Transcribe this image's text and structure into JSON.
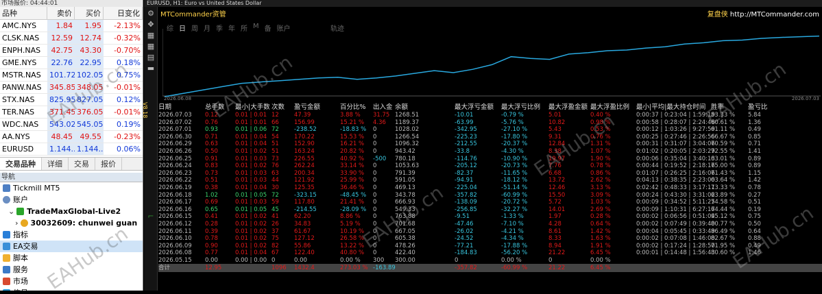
{
  "market_watch": {
    "title": "市场报价: 04:44:01",
    "headers": [
      "品种",
      "卖价",
      "买价",
      "日变化"
    ],
    "rows": [
      {
        "sym": "AMC.NYS",
        "bid": "1.84",
        "ask": "1.95",
        "chg": "-2.13%",
        "dir": "dn"
      },
      {
        "sym": "CLSK.NAS",
        "bid": "12.59",
        "ask": "12.74",
        "chg": "-0.32%",
        "dir": "dn"
      },
      {
        "sym": "ENPH.NAS",
        "bid": "42.75",
        "ask": "43.30",
        "chg": "-0.70%",
        "dir": "dn"
      },
      {
        "sym": "GME.NYS",
        "bid": "22.76",
        "ask": "22.95",
        "chg": "0.18%",
        "dir": "up"
      },
      {
        "sym": "MSTR.NAS",
        "bid": "101.72",
        "ask": "102.05",
        "chg": "0.75%",
        "dir": "up"
      },
      {
        "sym": "PANW.NAS",
        "bid": "345.85",
        "ask": "348.05",
        "chg": "-0.01%",
        "dir": "dn"
      },
      {
        "sym": "STX.NAS",
        "bid": "825.95",
        "ask": "827.05",
        "chg": "0.12%",
        "dir": "up"
      },
      {
        "sym": "TER.NAS",
        "bid": "371.45",
        "ask": "376.05",
        "chg": "-0.01%",
        "dir": "dn"
      },
      {
        "sym": "WDC.NAS",
        "bid": "543.02",
        "ask": "545.05",
        "chg": "0.19%",
        "dir": "up"
      },
      {
        "sym": "AA.NYS",
        "bid": "48.45",
        "ask": "49.55",
        "chg": "-0.23%",
        "dir": "dn"
      },
      {
        "sym": "EURUSD",
        "bid": "1.144...",
        "ask": "1.144...",
        "chg": "0.06%",
        "dir": "up"
      }
    ],
    "tabs": [
      "交易品种",
      "详细",
      "交易",
      "报价"
    ]
  },
  "navigator": {
    "title": "导航",
    "items": [
      "Tickmill MT5",
      "账户",
      "TradeMaxGlobal-Live2",
      "30032609: chunwei guan",
      "指标",
      "EA交易",
      "脚本",
      "服务",
      "市场",
      "信号"
    ]
  },
  "chart_header": "EURUSD, H1: Euro vs United States Dollar",
  "panel": {
    "title": "MTCommander资管",
    "fuping_label": "复盘侠",
    "url": "http://MTCommander.com",
    "tabs": [
      "综",
      "日",
      "周",
      "月",
      "季",
      "年",
      "所",
      "M",
      "备",
      "账户"
    ],
    "track_label": "轨迹",
    "date_start": "2026.06.08",
    "date_end": "2026.07.03",
    "side_label": "V8.18",
    "watermark": "EAHub.cn"
  },
  "chart_data": {
    "type": "line",
    "x": [
      "2026.06.08",
      "2026.07.03"
    ],
    "values": [
      0,
      10,
      20,
      30,
      40,
      44,
      48,
      52,
      56,
      58,
      52,
      56,
      62,
      70,
      78,
      72,
      82,
      96,
      120,
      115,
      112,
      128,
      132,
      138,
      140,
      146,
      150,
      158,
      162,
      168,
      170,
      175,
      178,
      180,
      182
    ],
    "color": "#29a9e0"
  },
  "table": {
    "headers": [
      "日期",
      "总手数",
      "最小|大手数",
      "次数",
      "盈亏金额",
      "百分比%",
      "出入金",
      "余额",
      "最大浮亏金额",
      "最大浮亏比例",
      "最大浮盈金额",
      "最大浮盈比例",
      "最小|平均|最大持仓时间",
      "胜率",
      "盈亏比"
    ],
    "rows": [
      [
        "2026.07.03",
        "0.12",
        "0.01 | 0.01",
        "12",
        "47.39",
        "3.88 %",
        "31.75",
        "1268.51",
        "-10.01",
        "-0.79 %",
        "5.01",
        "0.40 %",
        "0:00:37 | 0:23:04 | 1:59:15",
        "83.33 %",
        "5.84",
        "r"
      ],
      [
        "2026.07.02",
        "0.76",
        "0.01 | 0.01",
        "66",
        "156.99",
        "15.21 %",
        "4.36",
        "1189.37",
        "-63.99",
        "-5.76 %",
        "10.82",
        "0.98 %",
        "0:00:58 | 0:28:07 | 2:24:48",
        "60.61 %",
        "1.36",
        "r"
      ],
      [
        "2026.07.01",
        "0.93",
        "0.01 | 0.06",
        "72",
        "-238.52",
        "-18.83 %",
        "0",
        "1028.02",
        "-342.95",
        "-27.10 %",
        "5.43",
        "0.53 %",
        "0:00:12 | 1:03:26 | 9:27:59",
        "61.11 %",
        "0.49",
        "g"
      ],
      [
        "2026.06.30",
        "0.71",
        "0.01 | 0.04",
        "54",
        "170.22",
        "15.53 %",
        "0",
        "1266.54",
        "-225.23",
        "-17.80 %",
        "9.31",
        "0.76 %",
        "0:00:25 | 0:27:46 | 2:26:56",
        "66.67 %",
        "0.85",
        "r"
      ],
      [
        "2026.06.29",
        "0.63",
        "0.01 | 0.04",
        "51",
        "152.90",
        "16.21 %",
        "0",
        "1096.32",
        "-212.55",
        "-20.37 %",
        "12.84",
        "1.31 %",
        "0:00:31 | 0:31:07 | 3:04:06",
        "70.59 %",
        "0.71",
        "r"
      ],
      [
        "2026.06.26",
        "0.50",
        "0.01 | 0.02",
        "51",
        "163.24",
        "20.82 %",
        "0",
        "943.42",
        "-33.8",
        "-4.30 %",
        "8.38",
        "1.07 %",
        "0:01:02 | 0:20:05 | 2:03:29",
        "72.55 %",
        "1.41",
        "r"
      ],
      [
        "2026.06.25",
        "0.91",
        "0.01 | 0.03",
        "73",
        "226.55",
        "40.92 %",
        "-500",
        "780.18",
        "-114.76",
        "-10.90 %",
        "19.97",
        "1.90 %",
        "0:00:06 | 0:35:04 | 3:40:13",
        "63.01 %",
        "0.89",
        "r"
      ],
      [
        "2026.06.24",
        "0.83",
        "0.01 | 0.02",
        "76",
        "262.24",
        "33.14 %",
        "0",
        "1053.63",
        "-205.12",
        "-20.73 %",
        "7.76",
        "0.78 %",
        "0:00:44 | 0:19:52 | 2:18:16",
        "75.00 %",
        "0.89",
        "r"
      ],
      [
        "2026.06.23",
        "0.73",
        "0.01 | 0.03",
        "63",
        "200.34",
        "33.90 %",
        "0",
        "791.39",
        "-82.37",
        "-11.65 %",
        "6.68",
        "0.86 %",
        "0:01:07 | 0:26:25 | 2:16:06",
        "71.43 %",
        "1.15",
        "r"
      ],
      [
        "2026.06.22",
        "0.51",
        "0.01 | 0.03",
        "44",
        "121.92",
        "25.99 %",
        "0",
        "591.05",
        "-94.91",
        "-18.12 %",
        "13.72",
        "2.62 %",
        "0:04:13 | 0:38:35 | 2:23:00",
        "63.64 %",
        "1.42",
        "r"
      ],
      [
        "2026.06.19",
        "0.38",
        "0.01 | 0.04",
        "30",
        "125.35",
        "36.46 %",
        "0",
        "469.13",
        "-225.04",
        "-51.14 %",
        "12.46",
        "3.13 %",
        "0:02:42 | 0:48:33 | 3:17:11",
        "73.33 %",
        "0.78",
        "r"
      ],
      [
        "2026.06.18",
        "1.02",
        "0.01 | 0.05",
        "72",
        "-323.15",
        "-48.45 %",
        "0",
        "343.78",
        "-357.82",
        "-60.99 %",
        "15.50",
        "3.09 %",
        "0:00:24 | 0:43:30 | 3:31:02",
        "63.89 %",
        "0.27",
        "g"
      ],
      [
        "2026.06.17",
        "0.69",
        "0.01 | 0.03",
        "59",
        "117.80",
        "21.41 %",
        "0",
        "666.93",
        "-138.09",
        "-20.72 %",
        "5.72",
        "1.03 %",
        "0:00:09 | 0:34:52 | 5:11:25",
        "74.58 %",
        "0.51",
        "r"
      ],
      [
        "2026.06.16",
        "0.65",
        "0.01 | 0.05",
        "45",
        "-214.55",
        "-28.09 %",
        "0",
        "549.33",
        "-256.85",
        "-32.27 %",
        "14.01",
        "2.69 %",
        "0:00:09 | 1:10:31 | 6:27:17",
        "64.44 %",
        "0.19",
        "g"
      ],
      [
        "2026.06.15",
        "0.41",
        "0.01 | 0.02",
        "41",
        "62.20",
        "8.86 %",
        "0",
        "763.88",
        "-9.51",
        "-1.33 %",
        "1.97",
        "0.28 %",
        "0:00:02 | 0:06:56 | 0:51:04",
        "95.12 %",
        "0.75",
        "r"
      ],
      [
        "2026.06.12",
        "0.28",
        "0.01 | 0.02",
        "26",
        "34.83",
        "5.19 %",
        "0",
        "701.68",
        "-47.46",
        "-7.10 %",
        "4.28",
        "0.64 %",
        "0:00:02 | 0:07:49 | 0:39:40",
        "80.77 %",
        "0.50",
        "r"
      ],
      [
        "2026.06.11",
        "0.39",
        "0.01 | 0.02",
        "37",
        "61.67",
        "10.19 %",
        "0",
        "667.05",
        "-26.02",
        "-4.21 %",
        "8.61",
        "1.42 %",
        "0:00:04 | 0:05:45 | 0:33:49",
        "86.49 %",
        "0.64",
        "r"
      ],
      [
        "2026.06.10",
        "0.78",
        "0.01 | 0.02",
        "75",
        "127.12",
        "26.58 %",
        "0",
        "605.38",
        "-24.52",
        "-4.34 %",
        "8.33",
        "1.63 %",
        "0:00:02 | 0:07:08 | 1:46:00",
        "82.67 %",
        "0.88",
        "r"
      ],
      [
        "2026.06.09",
        "0.90",
        "0.01 | 0.02",
        "82",
        "55.86",
        "13.22 %",
        "0",
        "478.26",
        "-77.21",
        "-17.88 %",
        "8.94",
        "1.91 %",
        "0:00:02 | 0:17:24 | 1:28:50",
        "71.95 %",
        "0.49",
        "r"
      ],
      [
        "2026.06.08",
        "0.77",
        "0.01 | 0.04",
        "67",
        "122.40",
        "40.80 %",
        "0",
        "422.40",
        "-184.83",
        "-56.20 %",
        "21.22",
        "6.45 %",
        "0:00:01 | 0:14:48 | 1:56:43",
        "80.60 %",
        "1.46",
        "r"
      ],
      [
        "2026.05.15",
        "0.00",
        "0.00 | 0.00",
        "0",
        "0.00",
        "0.00 %",
        "300",
        "300.00",
        "0",
        "0.00 %",
        "0",
        "0.00 %",
        "",
        "",
        "",
        "z"
      ]
    ],
    "total": [
      "合计",
      "12.95",
      "",
      "1096",
      "1432.4",
      "273.03 %",
      "-163.89",
      "",
      "-357.82",
      "-60.99 %",
      "21.22",
      "6.45 %",
      "",
      "",
      ""
    ]
  }
}
